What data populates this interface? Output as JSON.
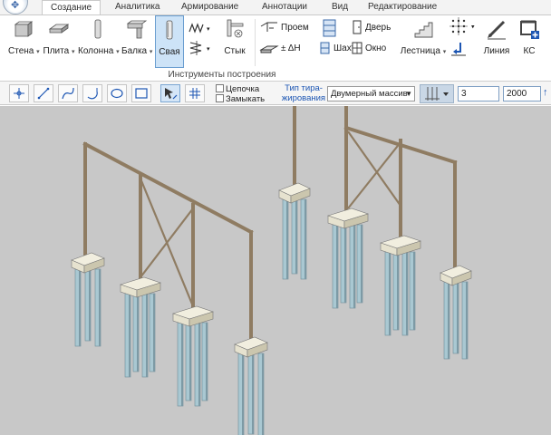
{
  "tabs": [
    {
      "label": "Создание",
      "active": true
    },
    {
      "label": "Аналитика",
      "active": false
    },
    {
      "label": "Армирование",
      "active": false
    },
    {
      "label": "Аннотации",
      "active": false
    },
    {
      "label": "Вид",
      "active": false
    },
    {
      "label": "Редактирование",
      "active": false
    }
  ],
  "ribbon": {
    "big_buttons": [
      {
        "label": "Стена",
        "icon": "wall-icon",
        "has_dropdown": true
      },
      {
        "label": "Плита",
        "icon": "slab-icon",
        "has_dropdown": true
      },
      {
        "label": "Колонна",
        "icon": "column-icon",
        "has_dropdown": true
      },
      {
        "label": "Балка",
        "icon": "beam-icon",
        "has_dropdown": true
      },
      {
        "label": "Свая",
        "icon": "pile-icon",
        "has_dropdown": false,
        "selected": true
      },
      {
        "label": "Стык",
        "icon": "joint-icon",
        "has_dropdown": false
      },
      {
        "label": "Лестница",
        "icon": "stair-icon",
        "has_dropdown": true
      },
      {
        "label": "Линия",
        "icon": "line-icon",
        "has_dropdown": false
      },
      {
        "label": "КС",
        "icon": "coordinate-system-icon",
        "has_dropdown": false
      }
    ],
    "small_buttons": [
      {
        "label": "Проем",
        "icon": "opening-icon"
      },
      {
        "label": "± ΔН",
        "icon": "level-offset-icon"
      },
      {
        "label": "Шахта",
        "icon": "shaft-icon"
      },
      {
        "label": "Окно",
        "icon": "window-icon"
      },
      {
        "label": "Дверь",
        "icon": "door-icon"
      }
    ],
    "group_caption": "Инструменты построения"
  },
  "toolbar": {
    "options": [
      {
        "label": "Цепочка",
        "checked": false
      },
      {
        "label": "Замыкать",
        "checked": false
      }
    ],
    "replication_label_line1": "Тип тира-",
    "replication_label_line2": "жирования",
    "replication_value": "Двумерный массив",
    "count_value": "3",
    "spacing_value": "2000"
  },
  "colors": {
    "accent": "#1d56b3",
    "viewport_bg": "#c8c8c8",
    "pile": "#a9c8d2",
    "pile_cap": "#e6e2cf",
    "frame": "#8f7c62"
  }
}
